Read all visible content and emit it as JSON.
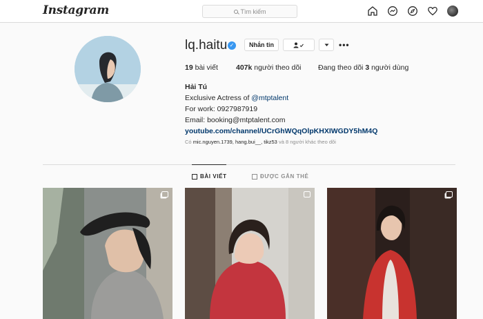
{
  "nav": {
    "logo_text": "Instagram",
    "search_placeholder": "Tìm kiếm",
    "icons": [
      "home-icon",
      "messenger-icon",
      "explore-icon",
      "heart-icon",
      "profile-avatar"
    ]
  },
  "profile": {
    "username": "lq.haitu",
    "verified": true,
    "message_button": "Nhắn tin",
    "follow_button_icon": "person-check-icon",
    "dropdown_icon": "caret-down-icon",
    "more_icon": "more-icon",
    "stats": {
      "posts_count": "19",
      "posts_label": "bài viết",
      "followers_count": "407k",
      "followers_label": "người theo dõi",
      "following_prefix": "Đang theo dõi",
      "following_count": "3",
      "following_suffix": "người dùng"
    },
    "bio": {
      "full_name": "Hải Tú",
      "line1_prefix": "Exclusive Actress of ",
      "line1_mention": "@mtptalent",
      "line2": "For work: 0927987919",
      "line3": "Email: booking@mtptalent.com",
      "website": "youtube.com/channel/UCrGhWQqOlpKHXIWGDY5hM4Q"
    },
    "followed_by": {
      "prefix": "Có",
      "users": "mic.nguyen.1739, hang.bui__, tikz53",
      "suffix": "và 8 người khác theo dõi"
    }
  },
  "tabs": {
    "posts": "BÀI VIẾT",
    "tagged": "ĐƯỢC GẮN THẺ",
    "active": "posts"
  },
  "posts": [
    {
      "badge": "multiple-posts-icon"
    },
    {
      "badge": "video-icon"
    },
    {
      "badge": "multiple-posts-icon"
    }
  ],
  "colors": {
    "verified": "#3897f0",
    "link": "#00376b",
    "border": "#dbdbdb",
    "background": "#fafafa"
  }
}
